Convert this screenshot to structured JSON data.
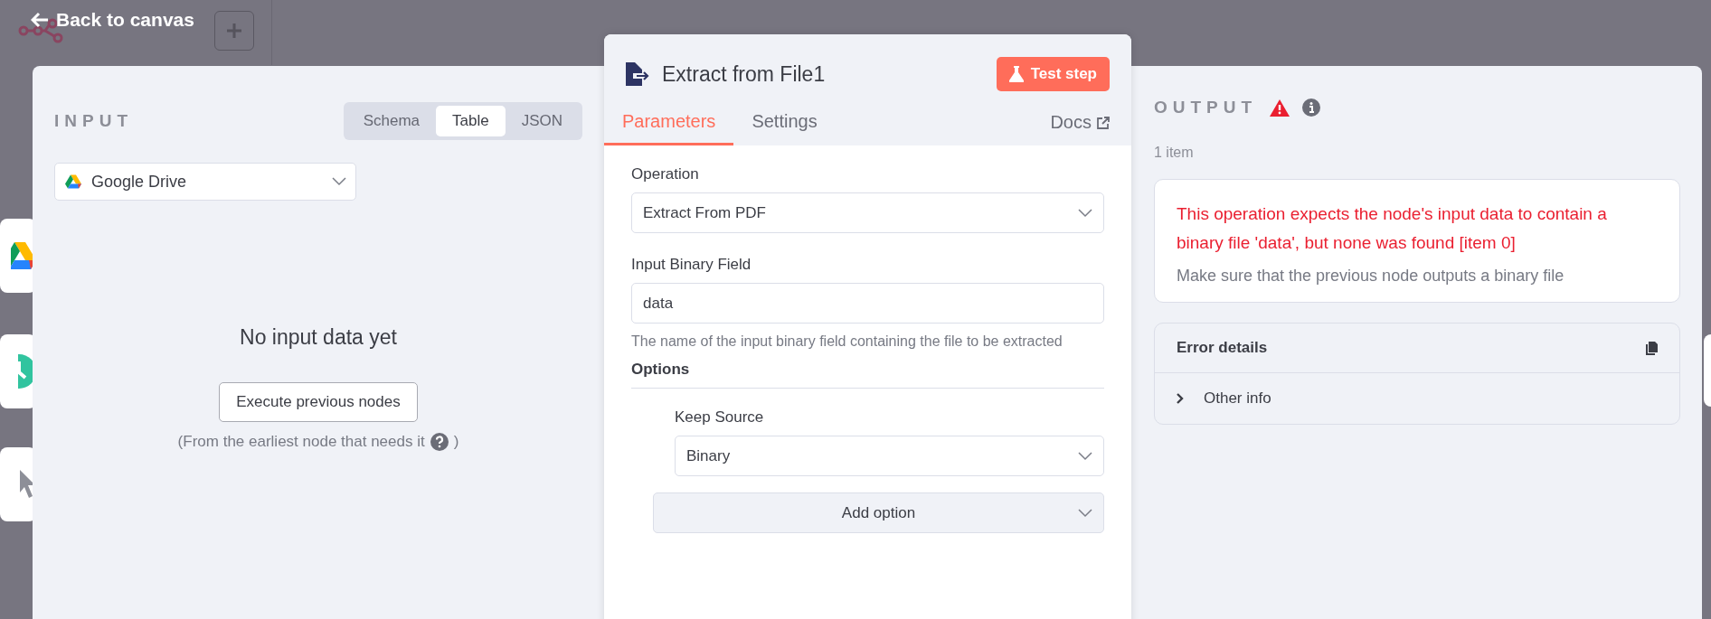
{
  "back_link": {
    "label": "Back to canvas"
  },
  "canvas": {
    "nodes": [
      {
        "kind": "drive"
      },
      {
        "kind": "clock"
      },
      {
        "kind": "cursor"
      }
    ]
  },
  "input_panel": {
    "title": "INPUT",
    "view_tabs": [
      {
        "label": "Schema",
        "selected": false
      },
      {
        "label": "Table",
        "selected": true
      },
      {
        "label": "JSON",
        "selected": false
      }
    ],
    "source_select": {
      "value": "Google Drive"
    },
    "empty_title": "No input data yet",
    "execute_button": "Execute previous nodes",
    "hint_start": "(From the earliest node that needs it",
    "hint_end": ")"
  },
  "node_panel": {
    "title": "Extract from File1",
    "test_button": "Test step",
    "tabs": [
      {
        "label": "Parameters",
        "selected": true
      },
      {
        "label": "Settings",
        "selected": false
      }
    ],
    "docs_link": "Docs",
    "operation": {
      "label": "Operation",
      "value": "Extract From PDF"
    },
    "binary_field": {
      "label": "Input Binary Field",
      "value": "data",
      "hint": "The name of the input binary field containing the file to be extracted"
    },
    "options": {
      "title": "Options",
      "items": [
        {
          "label": "Keep Source",
          "value": "Binary"
        }
      ],
      "add_button": "Add option"
    }
  },
  "output_panel": {
    "title": "OUTPUT",
    "count": "1 item",
    "error": {
      "message": "This operation expects the node's input data to contain a binary file 'data', but none was found [item 0]",
      "hint": "Make sure that the previous node outputs a binary file"
    },
    "details": {
      "title": "Error details",
      "sections": [
        {
          "label": "Other info",
          "expanded": false
        }
      ]
    }
  }
}
